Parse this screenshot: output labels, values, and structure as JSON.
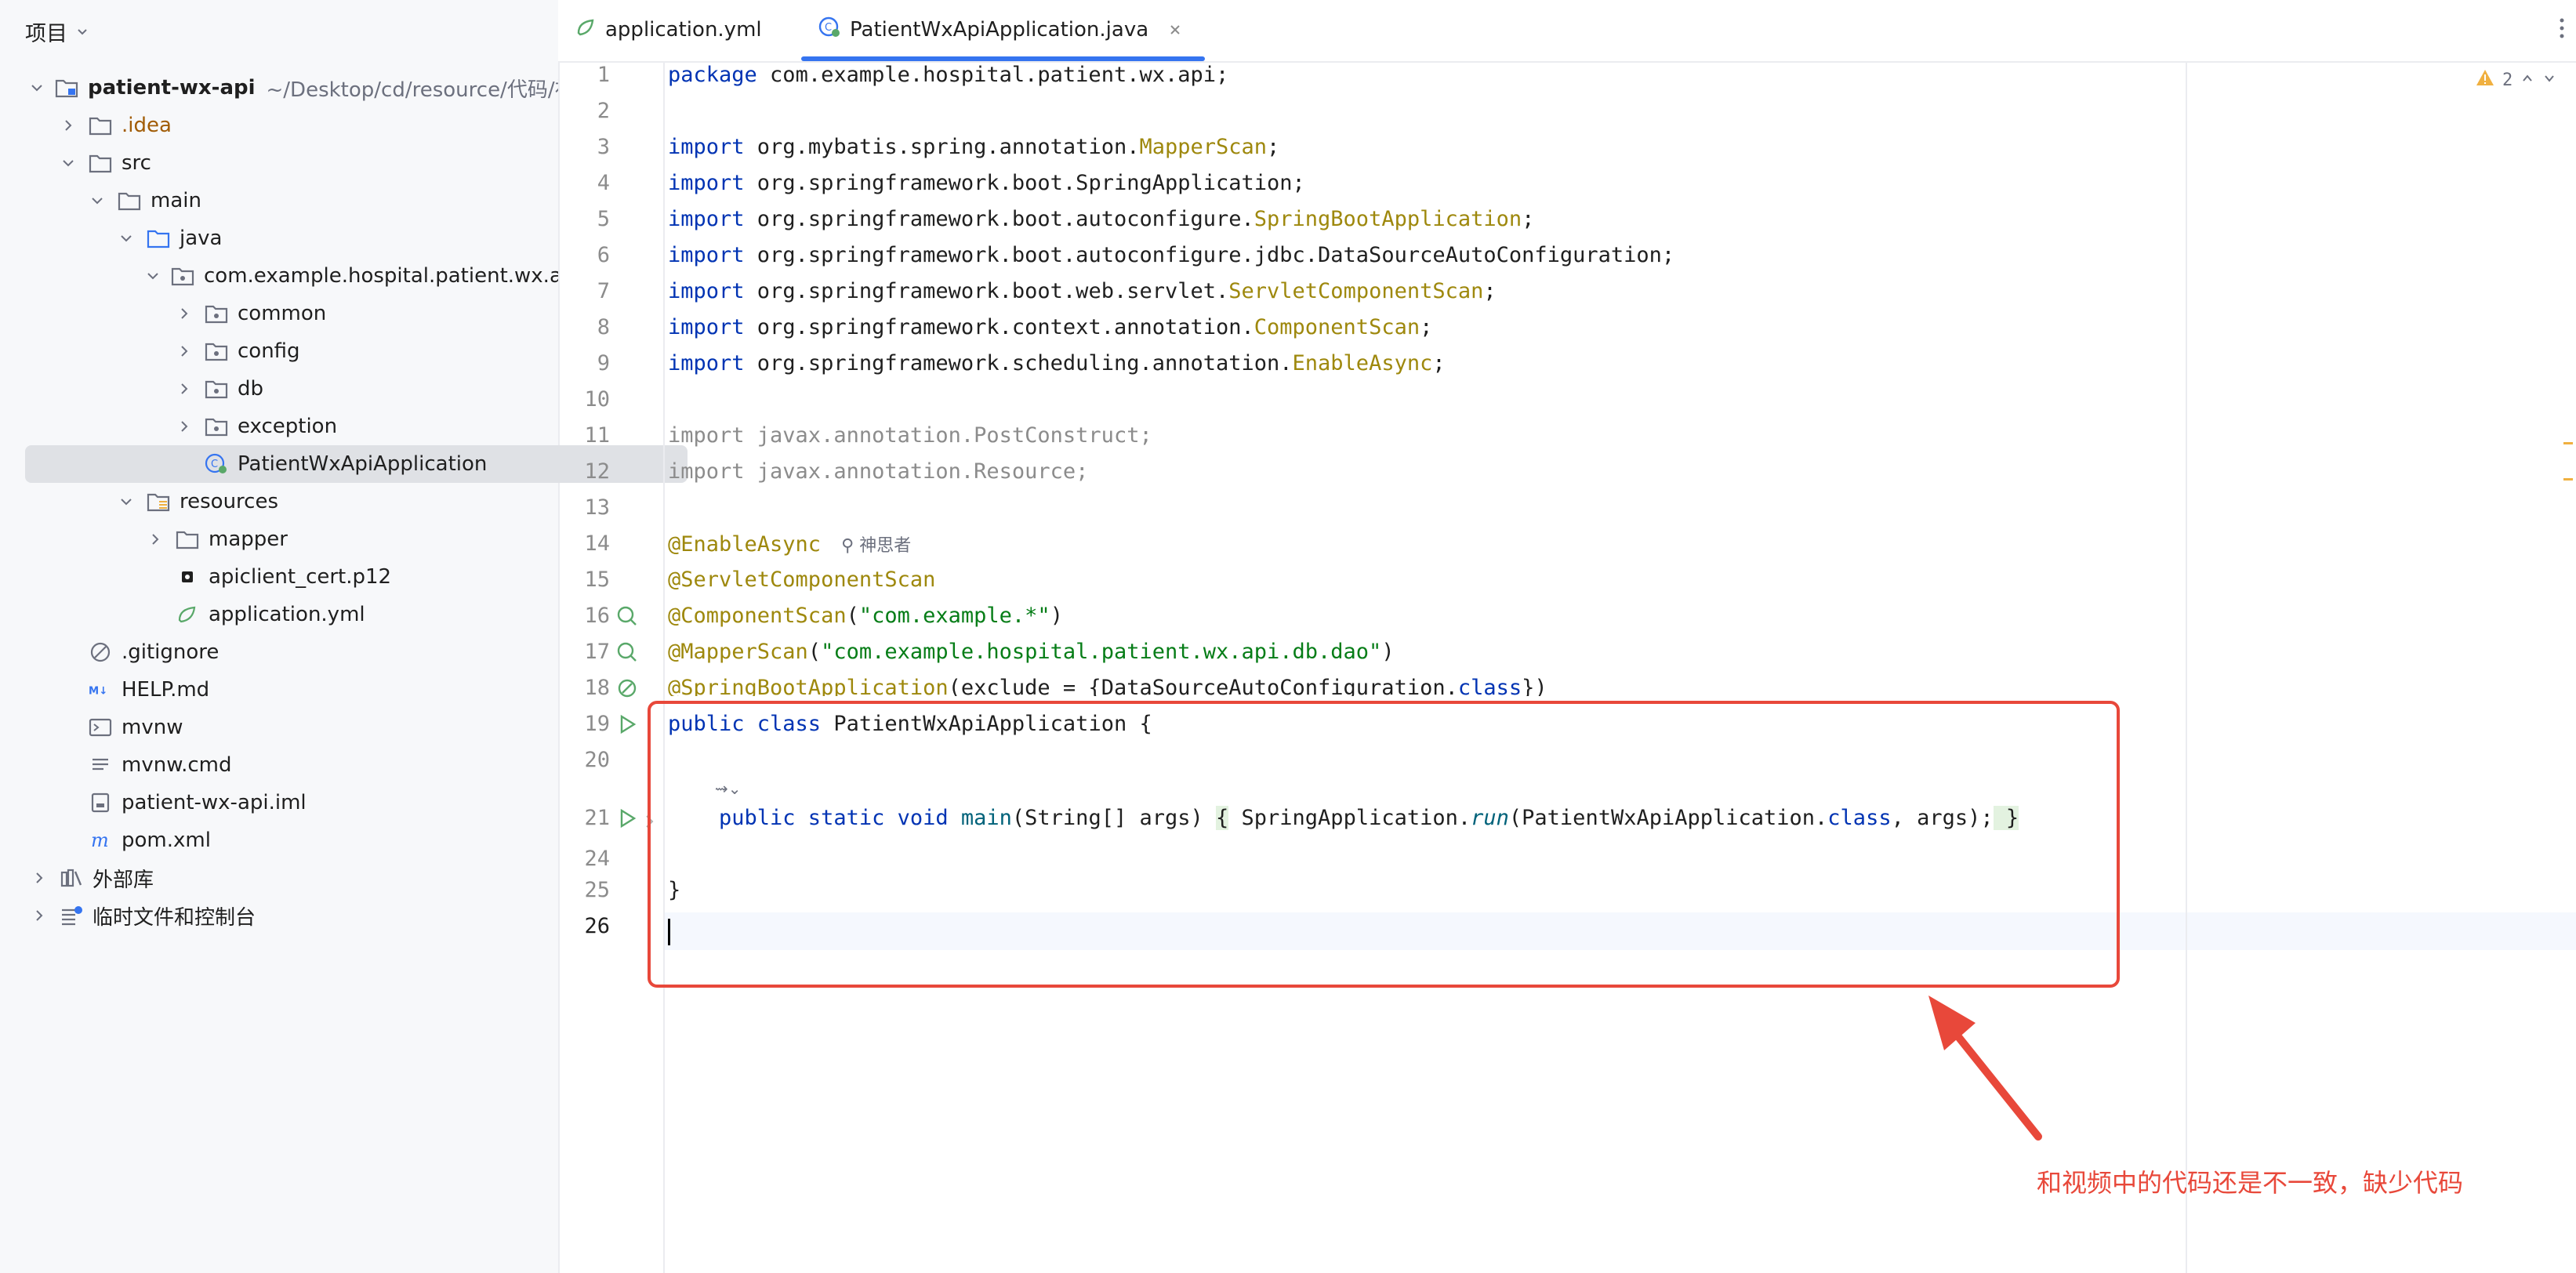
{
  "sidebar": {
    "title": "项目",
    "tree": [
      {
        "label": "patient-wx-api",
        "path": "~/Desktop/cd/resource/代码/初始",
        "icon": "module-folder-icon"
      },
      {
        "label": ".idea",
        "icon": "folder-icon"
      },
      {
        "label": "src",
        "icon": "folder-icon"
      },
      {
        "label": "main",
        "icon": "folder-icon"
      },
      {
        "label": "java",
        "icon": "source-folder-icon"
      },
      {
        "label": "com.example.hospital.patient.wx.api",
        "icon": "package-icon"
      },
      {
        "label": "common",
        "icon": "package-icon"
      },
      {
        "label": "config",
        "icon": "package-icon"
      },
      {
        "label": "db",
        "icon": "package-icon"
      },
      {
        "label": "exception",
        "icon": "package-icon"
      },
      {
        "label": "PatientWxApiApplication",
        "icon": "spring-class-icon"
      },
      {
        "label": "resources",
        "icon": "resources-folder-icon"
      },
      {
        "label": "mapper",
        "icon": "folder-icon"
      },
      {
        "label": "apiclient_cert.p12",
        "icon": "cert-file-icon"
      },
      {
        "label": "application.yml",
        "icon": "spring-yml-icon"
      },
      {
        "label": ".gitignore",
        "icon": "ignore-file-icon"
      },
      {
        "label": "HELP.md",
        "icon": "markdown-icon"
      },
      {
        "label": "mvnw",
        "icon": "shell-icon"
      },
      {
        "label": "mvnw.cmd",
        "icon": "text-file-icon"
      },
      {
        "label": "patient-wx-api.iml",
        "icon": "iml-file-icon"
      },
      {
        "label": "pom.xml",
        "icon": "maven-icon"
      },
      {
        "label": "外部库",
        "icon": "library-icon"
      },
      {
        "label": "临时文件和控制台",
        "icon": "scratches-icon"
      }
    ]
  },
  "tabs": [
    {
      "label": "application.yml"
    },
    {
      "label": "PatientWxApiApplication.java"
    }
  ],
  "editor": {
    "warning_count": "2",
    "author_hint": "神思者",
    "line_numbers": [
      "1",
      "2",
      "3",
      "4",
      "5",
      "6",
      "7",
      "8",
      "9",
      "10",
      "11",
      "12",
      "13",
      "14",
      "15",
      "16",
      "17",
      "18",
      "19",
      "20",
      "21",
      "24",
      "25",
      "26"
    ],
    "lines": {
      "l1": {
        "a": "package",
        "b": " com.example.hospital.patient.wx.api;"
      },
      "l3": {
        "a": "import",
        "b": " org.mybatis.spring.annotation.",
        "c": "MapperScan",
        ";": ";"
      },
      "l4": {
        "a": "import",
        "b": " org.springframework.boot.SpringApplication;"
      },
      "l5": {
        "a": "import",
        "b": " org.springframework.boot.autoconfigure.",
        "c": "SpringBootApplication"
      },
      "l6": {
        "a": "import",
        "b": " org.springframework.boot.autoconfigure.jdbc.DataSourceAutoConfiguration;"
      },
      "l7": {
        "a": "import",
        "b": " org.springframework.boot.web.servlet.",
        "c": "ServletComponentScan"
      },
      "l8": {
        "a": "import",
        "b": " org.springframework.context.annotation.",
        "c": "ComponentScan"
      },
      "l9": {
        "a": "import",
        "b": " org.springframework.scheduling.annotation.",
        "c": "EnableAsync"
      },
      "l11": "import javax.annotation.PostConstruct;",
      "l12": "import javax.annotation.Resource;",
      "l14": "@EnableAsync",
      "l15": "@ServletComponentScan",
      "l16": {
        "a": "@ComponentScan",
        "b": "(",
        "c": "\"com.example.*\"",
        "d": ")"
      },
      "l17": {
        "a": "@MapperScan",
        "b": "(",
        "c": "\"com.example.hospital.patient.wx.api.db.dao\"",
        "d": ")"
      },
      "l18": {
        "a": "@SpringBootApplication",
        "b": "(exclude = {DataSourceAutoConfiguration.",
        "c": "class",
        "d": "})"
      },
      "l19": {
        "a": "public class",
        "b": " PatientWxApiApplication {"
      },
      "l21": {
        "a": "    public static void",
        "b": " main",
        "c": "(String[] args) ",
        "d": "{",
        "e": " SpringApplication.",
        "f": "run",
        "g": "(PatientWxApiApplication.",
        "h": "class",
        ",": ", args);",
        "i": " ",
        "j": "}"
      },
      "l25": "}"
    }
  },
  "annotation": {
    "text": "和视频中的代码还是不一致，缺少代码",
    "color": "#e8483a"
  }
}
